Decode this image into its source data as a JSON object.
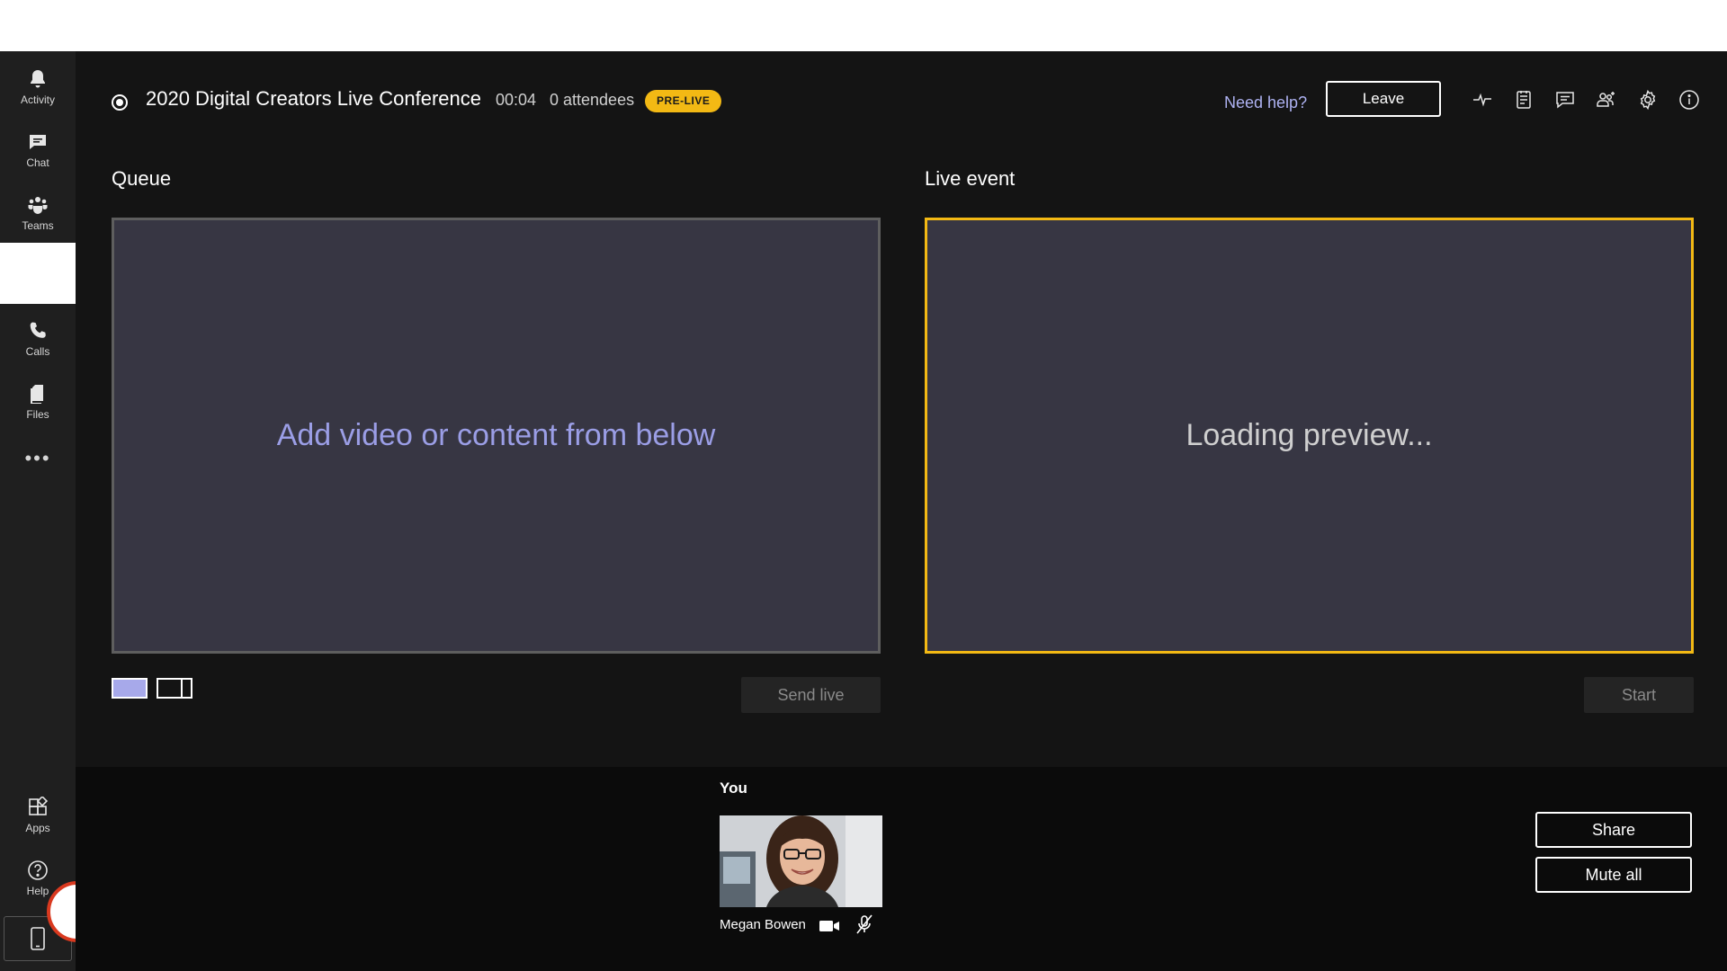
{
  "rail": {
    "items": [
      {
        "label": "Activity",
        "icon": "bell-icon"
      },
      {
        "label": "Chat",
        "icon": "chat-icon"
      },
      {
        "label": "Teams",
        "icon": "teams-icon"
      },
      {
        "label": "",
        "icon": "active-blank"
      },
      {
        "label": "Calls",
        "icon": "phone-icon"
      },
      {
        "label": "Files",
        "icon": "files-icon"
      }
    ],
    "more": "•••",
    "apps_label": "Apps",
    "help_label": "Help"
  },
  "header": {
    "title": "2020 Digital Creators Live Conference",
    "timer": "00:04",
    "attendees": "0 attendees",
    "status_badge": "PRE-LIVE",
    "need_help": "Need help?",
    "leave": "Leave"
  },
  "queue": {
    "label": "Queue",
    "placeholder": "Add video or content from below",
    "send_live": "Send live"
  },
  "live_event": {
    "label": "Live event",
    "status": "Loading preview...",
    "start": "Start"
  },
  "participants": {
    "you_label": "You",
    "name": "Megan Bowen"
  },
  "actions": {
    "share": "Share",
    "mute_all": "Mute all"
  },
  "colors": {
    "accent": "#f3b914",
    "queue_text": "#9b9ee6",
    "panel_bg": "#373643",
    "help_link": "#aeb2f2"
  }
}
